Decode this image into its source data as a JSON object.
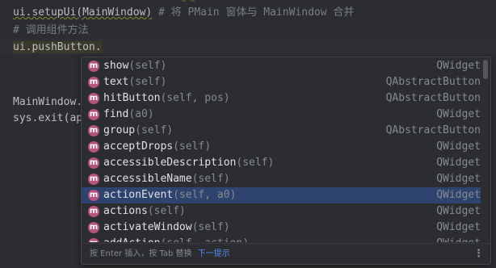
{
  "editor": {
    "line1_code": "ui.setupUi(MainWindow)",
    "line1_comment": " # 将 PMain 窗体与 MainWindow 合并",
    "line2_comment": "# 调用组件方法",
    "line3_code": "ui.pushButton.",
    "line5_code": "MainWindow.",
    "line6_code": "sys.exit(ap"
  },
  "completion": {
    "items": [
      {
        "icon": "m",
        "name": "show",
        "params": "(self)",
        "cls": "QWidget"
      },
      {
        "icon": "m",
        "name": "text",
        "params": "(self)",
        "cls": "QAbstractButton"
      },
      {
        "icon": "m",
        "name": "hitButton",
        "params": "(self, pos)",
        "cls": "QAbstractButton"
      },
      {
        "icon": "m",
        "name": "find",
        "params": "(a0)",
        "cls": "QWidget"
      },
      {
        "icon": "m",
        "name": "group",
        "params": "(self)",
        "cls": "QAbstractButton"
      },
      {
        "icon": "m",
        "name": "acceptDrops",
        "params": "(self)",
        "cls": "QWidget"
      },
      {
        "icon": "m",
        "name": "accessibleDescription",
        "params": "(self)",
        "cls": "QWidget"
      },
      {
        "icon": "m",
        "name": "accessibleName",
        "params": "(self)",
        "cls": "QWidget"
      },
      {
        "icon": "m",
        "name": "actionEvent",
        "params": "(self, a0)",
        "cls": "QWidget"
      },
      {
        "icon": "m",
        "name": "actions",
        "params": "(self)",
        "cls": "QWidget"
      },
      {
        "icon": "m",
        "name": "activateWindow",
        "params": "(self)",
        "cls": "QWidget"
      },
      {
        "icon": "m",
        "name": "addAction",
        "params": "(self, action)",
        "cls": "QWidget"
      }
    ],
    "selected_index": 8,
    "footer_text": "按 Enter 插入，按 Tab 替换",
    "footer_link": "下一提示",
    "more_icon": "more-vertical-icon"
  },
  "colors": {
    "selected_bg": "#2e436e",
    "method_icon": "#b5547e",
    "link": "#548af7"
  }
}
